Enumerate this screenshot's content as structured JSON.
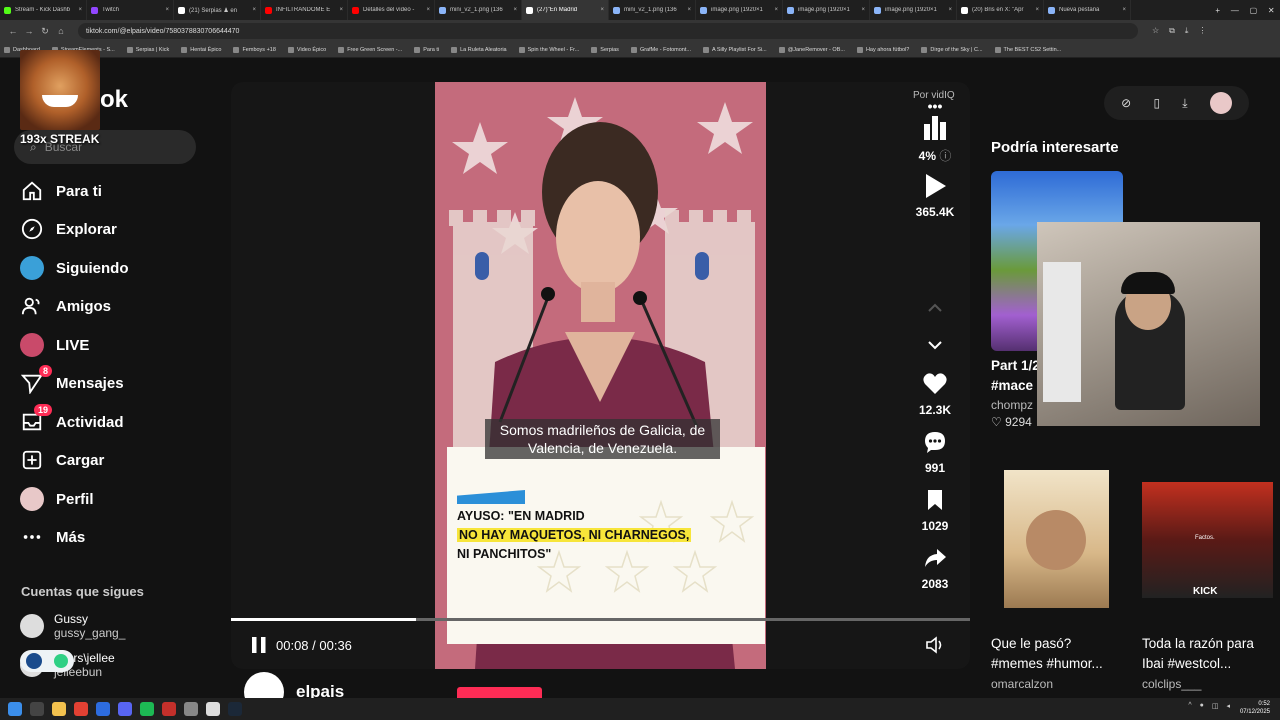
{
  "browser": {
    "tabs": [
      {
        "title": "Stream - Kick Dashb",
        "color": "#53fc18"
      },
      {
        "title": "Twitch",
        "color": "#9146ff"
      },
      {
        "title": "(21) Serpias ♟ en",
        "color": "#ffffff"
      },
      {
        "title": "INFILTRANDOME E",
        "color": "#ff0000"
      },
      {
        "title": "Detalles del vídeo -",
        "color": "#ff0000"
      },
      {
        "title": "mini_v2_1.png (136",
        "color": "#8ab4f8"
      },
      {
        "title": "(27)\"En Madrid",
        "color": "#ffffff"
      },
      {
        "title": "mini_v2_1.png (136",
        "color": "#8ab4f8"
      },
      {
        "title": "image.png (1920×1",
        "color": "#8ab4f8"
      },
      {
        "title": "image.png (1920×1",
        "color": "#8ab4f8"
      },
      {
        "title": "image.png (1920×1",
        "color": "#8ab4f8"
      },
      {
        "title": "(20) Bris en X: \"Apr",
        "color": "#ffffff"
      },
      {
        "title": "Nueva pestaña",
        "color": "#8ab4f8"
      }
    ],
    "active_tab": 6,
    "url": "tiktok.com/@elpais/video/7580378830706644470",
    "bookmarks": [
      "Dashboard",
      "StreamElements - S...",
      "Serpias | Kick",
      "Hentai Épico",
      "Femboys +18",
      "Video Épico",
      "Free Green Screen -...",
      "Para ti",
      "La Ruleta Aleatoria",
      "Spin the Wheel - Fr...",
      "Serpias",
      "GrafMe - Fotomont...",
      "A Silly Playlist For Si...",
      "@JaneRemover - OB...",
      "Hay ahora fútbol?",
      "Dirge of the Sky | C...",
      "The BEST CS2 Settin..."
    ]
  },
  "overlay": {
    "streak": "193x STREAK",
    "logo_fragment": "ok"
  },
  "sidebar": {
    "search_placeholder": "Buscar",
    "items": [
      {
        "label": "Para ti",
        "icon": "home-icon"
      },
      {
        "label": "Explorar",
        "icon": "compass-icon"
      },
      {
        "label": "Siguiendo",
        "icon": "following-avatar"
      },
      {
        "label": "Amigos",
        "icon": "friends-icon"
      },
      {
        "label": "LIVE",
        "icon": "live-avatar"
      },
      {
        "label": "Mensajes",
        "icon": "send-icon",
        "badge": "8"
      },
      {
        "label": "Actividad",
        "icon": "inbox-icon",
        "badge": "19"
      },
      {
        "label": "Cargar",
        "icon": "plus-square-icon"
      },
      {
        "label": "Perfil",
        "icon": "profile-avatar"
      },
      {
        "label": "Más",
        "icon": "more-icon"
      }
    ],
    "following_title": "Cuentas que sigues",
    "following": [
      {
        "name": "Gussy",
        "handle": "gussy_gang_"
      },
      {
        "name": "users\\jellee",
        "handle": "jelleebun"
      }
    ]
  },
  "video": {
    "subtitle": "Somos madrileños de Galicia, de Valencia, de Venezuela.",
    "headline_line1": "AYUSO: \"EN MADRID",
    "headline_line2": "NO HAY MAQUETOS, NI CHARNEGOS,",
    "headline_line3": "NI PANCHITOS\"",
    "time": "00:08 / 00:36",
    "progress": 0.25,
    "channel": "elpais"
  },
  "actions": {
    "vidiq_label": "Por vidIQ",
    "vidiq_percent": "4%",
    "views": "365.4K",
    "likes": "12.3K",
    "comments": "991",
    "saves": "1029",
    "shares": "2083"
  },
  "related": {
    "title": "Podría interesarte",
    "items": [
      {
        "title": "Part 1/2 #mace",
        "author": "chompz",
        "likes": "9294"
      },
      {
        "title": "Que le pasó? #memes #humor...",
        "author": "omarcalzon"
      },
      {
        "title": "Toda la razón para Ibai #westcol...",
        "author": "colclips___"
      }
    ],
    "thumb3_caption": "Factos.",
    "thumb3_brand": "KICK"
  },
  "system": {
    "time": "0:52",
    "date": "07/12/2025"
  },
  "colors": {
    "accent": "#fe2c55",
    "background": "#121212"
  }
}
